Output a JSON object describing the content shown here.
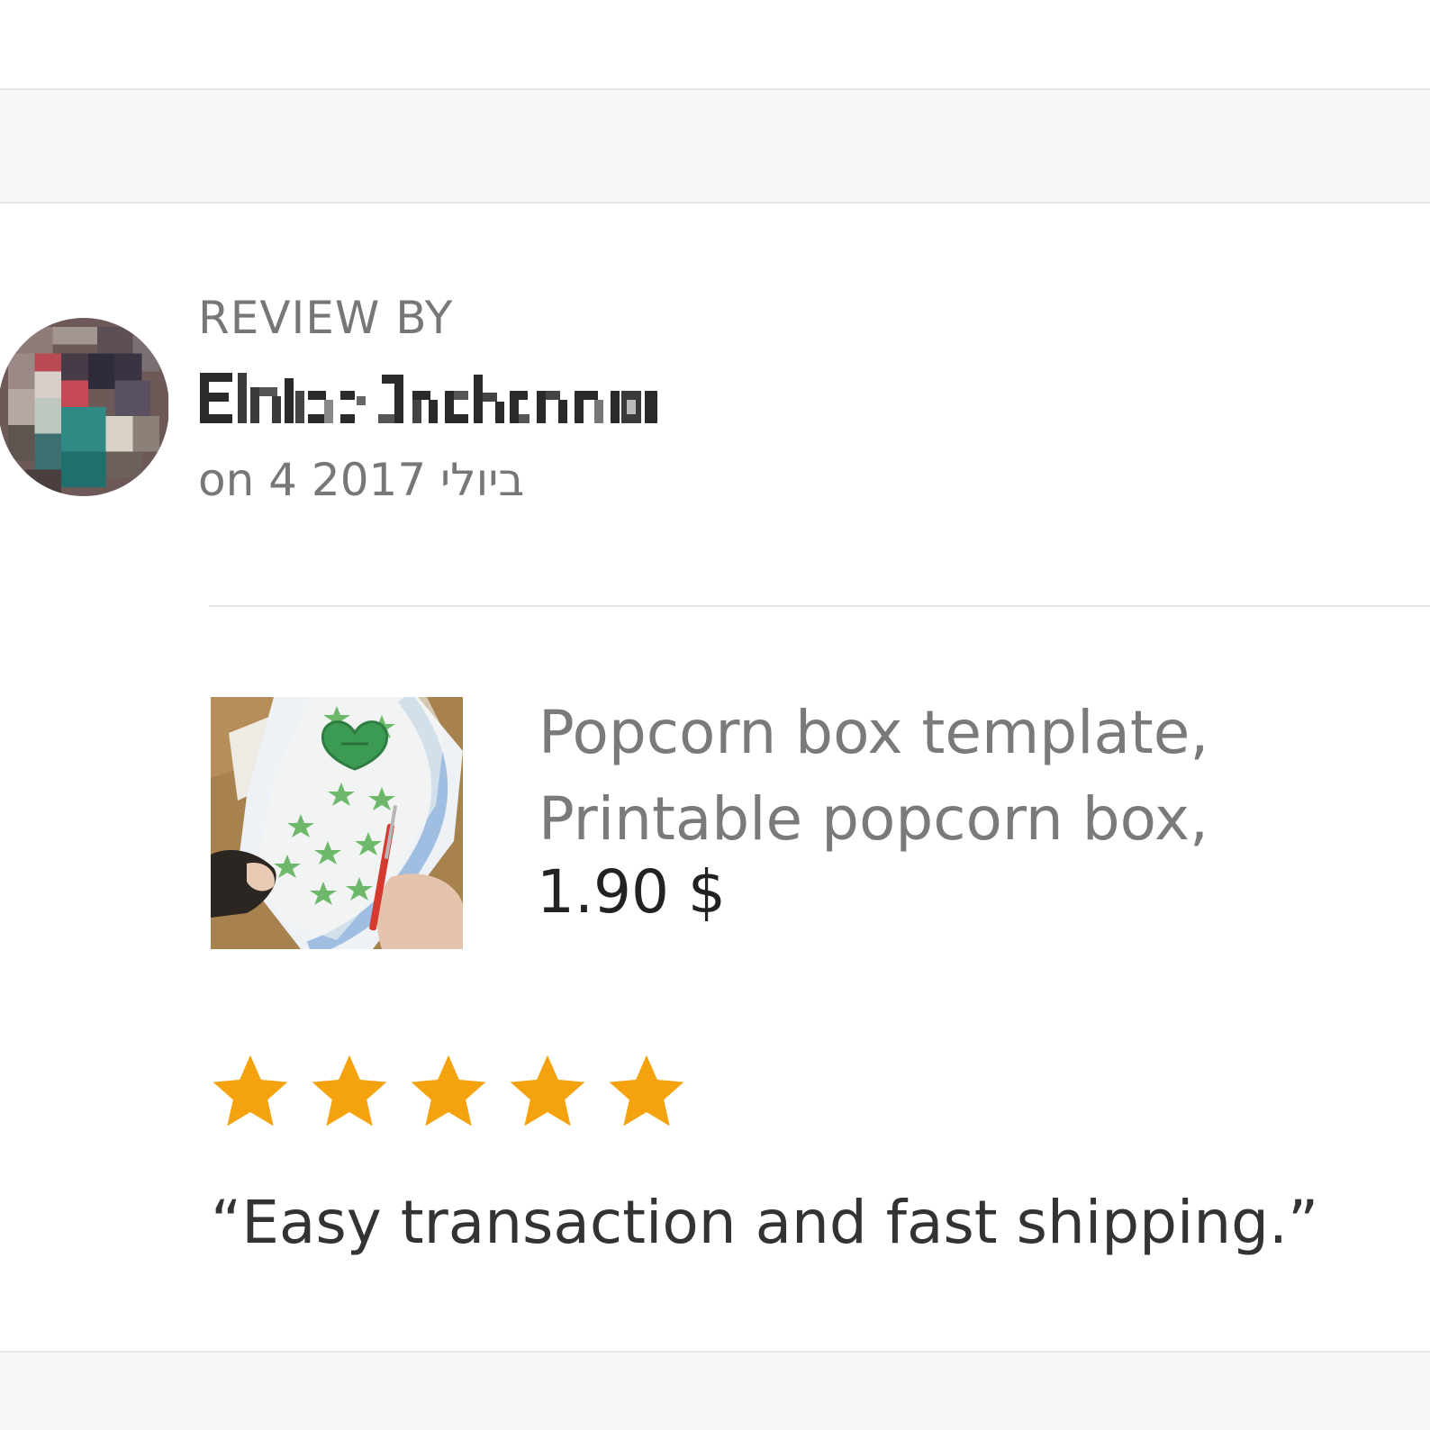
{
  "header": {
    "review_by_label": "REVIEW BY"
  },
  "review": {
    "reviewer_name": "Elsie Jackson",
    "date": "on 4 2017 ביולי",
    "rating": 5,
    "rating_max": 5,
    "text": "“Easy transaction and fast shipping.”"
  },
  "product": {
    "title_line1": "Popcorn box template,",
    "title_line2": "Printable popcorn box,",
    "price": "1.90 $",
    "thumbnail": "popcorn-box-craft-photo"
  },
  "colors": {
    "star": "#f5a20f",
    "muted_text": "#777777",
    "body_text": "#333333",
    "band_background": "#f8f8f6"
  },
  "icons": {
    "star": "star-icon"
  }
}
